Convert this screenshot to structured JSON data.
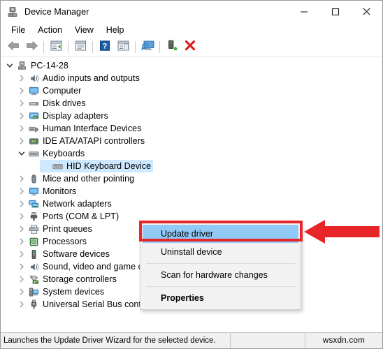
{
  "window": {
    "title": "Device Manager",
    "icon": "device-manager-icon",
    "controls": [
      {
        "name": "minimize-button",
        "glyph": "minimize-icon"
      },
      {
        "name": "maximize-button",
        "glyph": "maximize-icon"
      },
      {
        "name": "close-button",
        "glyph": "close-icon"
      }
    ]
  },
  "menubar": {
    "items": [
      {
        "label": "File",
        "name": "menu-file"
      },
      {
        "label": "Action",
        "name": "menu-action"
      },
      {
        "label": "View",
        "name": "menu-view"
      },
      {
        "label": "Help",
        "name": "menu-help"
      }
    ]
  },
  "toolbar": {
    "buttons": [
      {
        "name": "back-button",
        "icon": "back-arrow-icon"
      },
      {
        "name": "forward-button",
        "icon": "forward-arrow-icon"
      },
      {
        "name": "separator-1",
        "icon": "separator"
      },
      {
        "name": "show-hide-console-tree-button",
        "icon": "console-tree-icon"
      },
      {
        "name": "separator-2",
        "icon": "separator"
      },
      {
        "name": "properties-button",
        "icon": "properties-window-icon"
      },
      {
        "name": "separator-3",
        "icon": "separator"
      },
      {
        "name": "help-button",
        "icon": "help-question-icon"
      },
      {
        "name": "show-hide-action-pane-button",
        "icon": "action-pane-icon"
      },
      {
        "name": "separator-4",
        "icon": "separator"
      },
      {
        "name": "scan-hardware-changes-button",
        "icon": "scan-monitor-icon"
      },
      {
        "name": "separator-5",
        "icon": "separator"
      },
      {
        "name": "update-driver-button",
        "icon": "update-driver-icon"
      },
      {
        "name": "uninstall-device-button",
        "icon": "red-x-icon"
      }
    ]
  },
  "tree": {
    "root": {
      "label": "PC-14-28",
      "icon": "computer-root-icon",
      "expanded": true
    },
    "items": [
      {
        "label": "Audio inputs and outputs",
        "icon": "speaker-icon",
        "indent": 1,
        "expanded": false,
        "selected": false
      },
      {
        "label": "Computer",
        "icon": "monitor-icon",
        "indent": 1,
        "expanded": false,
        "selected": false
      },
      {
        "label": "Disk drives",
        "icon": "disk-drive-icon",
        "indent": 1,
        "expanded": false,
        "selected": false
      },
      {
        "label": "Display adapters",
        "icon": "display-adapter-icon",
        "indent": 1,
        "expanded": false,
        "selected": false
      },
      {
        "label": "Human Interface Devices",
        "icon": "hid-icon",
        "indent": 1,
        "expanded": false,
        "selected": false
      },
      {
        "label": "IDE ATA/ATAPI controllers",
        "icon": "ide-controller-icon",
        "indent": 1,
        "expanded": false,
        "selected": false
      },
      {
        "label": "Keyboards",
        "icon": "keyboard-icon",
        "indent": 1,
        "expanded": true,
        "selected": false
      },
      {
        "label": "HID Keyboard Device",
        "icon": "keyboard-icon",
        "indent": 2,
        "expanded": null,
        "selected": true
      },
      {
        "label": "Mice and other pointing",
        "icon": "mouse-icon",
        "indent": 1,
        "expanded": false,
        "selected": false
      },
      {
        "label": "Monitors",
        "icon": "monitor-icon",
        "indent": 1,
        "expanded": false,
        "selected": false
      },
      {
        "label": "Network adapters",
        "icon": "network-adapter-icon",
        "indent": 1,
        "expanded": false,
        "selected": false
      },
      {
        "label": "Ports (COM & LPT)",
        "icon": "port-icon",
        "indent": 1,
        "expanded": false,
        "selected": false
      },
      {
        "label": "Print queues",
        "icon": "printer-icon",
        "indent": 1,
        "expanded": false,
        "selected": false
      },
      {
        "label": "Processors",
        "icon": "processor-icon",
        "indent": 1,
        "expanded": false,
        "selected": false
      },
      {
        "label": "Software devices",
        "icon": "software-device-icon",
        "indent": 1,
        "expanded": false,
        "selected": false
      },
      {
        "label": "Sound, video and game controllers",
        "icon": "speaker-icon",
        "indent": 1,
        "expanded": false,
        "selected": false
      },
      {
        "label": "Storage controllers",
        "icon": "storage-controller-icon",
        "indent": 1,
        "expanded": false,
        "selected": false
      },
      {
        "label": "System devices",
        "icon": "system-device-icon",
        "indent": 1,
        "expanded": false,
        "selected": false
      },
      {
        "label": "Universal Serial Bus controllers",
        "icon": "usb-icon",
        "indent": 1,
        "expanded": false,
        "selected": false
      }
    ]
  },
  "context_menu": {
    "items": [
      {
        "label": "Update driver",
        "name": "ctx-update-driver",
        "highlighted": true,
        "bold": false,
        "separator_after": false
      },
      {
        "label": "Uninstall device",
        "name": "ctx-uninstall-device",
        "highlighted": false,
        "bold": false,
        "separator_after": true
      },
      {
        "label": "Scan for hardware changes",
        "name": "ctx-scan-hardware-changes",
        "highlighted": false,
        "bold": false,
        "separator_after": true
      },
      {
        "label": "Properties",
        "name": "ctx-properties",
        "highlighted": false,
        "bold": true,
        "separator_after": false
      }
    ]
  },
  "annotation": {
    "highlight_color": "#e8262a",
    "arrow": "left-pointing-arrow"
  },
  "statusbar": {
    "message": "Launches the Update Driver Wizard for the selected device.",
    "middle": "",
    "watermark": "wsxdn.com"
  },
  "colors": {
    "selection_blue": "#cde8ff",
    "menu_highlight_blue": "#91c9f7",
    "annotation_red": "#e8262a",
    "window_bg": "#ffffff",
    "menu_bg": "#f2f2f2",
    "statusbar_bg": "#f0f0f0"
  }
}
